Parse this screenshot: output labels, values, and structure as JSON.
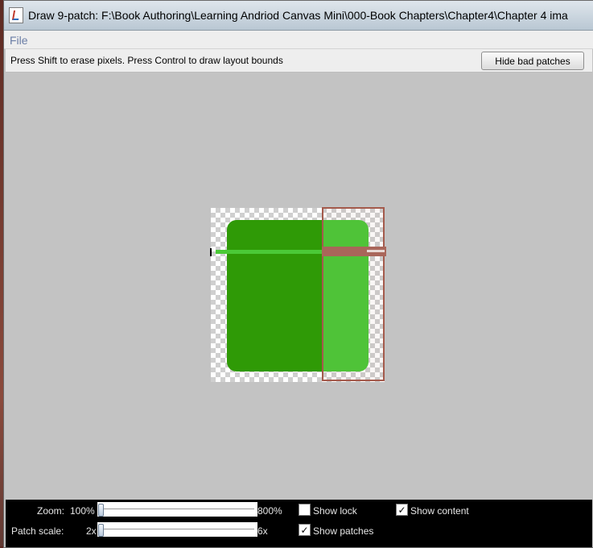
{
  "window": {
    "title": "Draw 9-patch: F:\\Book Authoring\\Learning Andriod Canvas Mini\\000-Book Chapters\\Chapter4\\Chapter 4 ima"
  },
  "menu": {
    "file": "File"
  },
  "info": {
    "hint": "Press Shift to erase pixels. Press Control to draw layout bounds",
    "hide_bad_patches": "Hide bad patches"
  },
  "controls": {
    "zoom_label": "Zoom:",
    "zoom_min": "100%",
    "zoom_max": "800%",
    "zoom_value_fraction": 0,
    "patch_scale_label": "Patch scale:",
    "patch_min": "2x",
    "patch_max": "6x",
    "patch_value_fraction": 0,
    "show_lock": {
      "label": "Show lock",
      "checked": false
    },
    "show_content": {
      "label": "Show content",
      "checked": true
    },
    "show_patches": {
      "label": "Show patches",
      "checked": true
    }
  },
  "colors": {
    "canvas_bg": "#c3c3c3",
    "patch_dark_green": "#2f9a06",
    "patch_light_green": "#4bc937",
    "bad_patch": "#a45a4c"
  }
}
